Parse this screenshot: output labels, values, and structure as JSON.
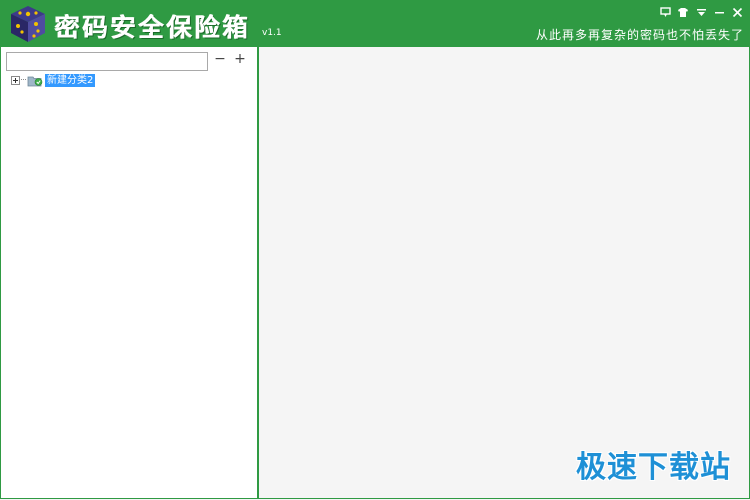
{
  "app": {
    "title": "密码安全保险箱",
    "version": "v1.1",
    "slogan": "从此再多再复杂的密码也不怕丢失了"
  },
  "window_controls": [
    {
      "name": "feedback-icon"
    },
    {
      "name": "skin-icon"
    },
    {
      "name": "menu-icon"
    },
    {
      "name": "minimize-icon"
    },
    {
      "name": "close-icon"
    }
  ],
  "sidebar": {
    "search": {
      "value": "",
      "placeholder": ""
    },
    "remove_label": "−",
    "add_label": "+",
    "tree": [
      {
        "label": "新建分类2",
        "selected": true,
        "icon": "folder-icon"
      }
    ]
  },
  "watermark": "极速下载站",
  "colors": {
    "titlebar": "#2f9a43",
    "selection": "#3399ff",
    "watermark": "#1e90d6"
  }
}
